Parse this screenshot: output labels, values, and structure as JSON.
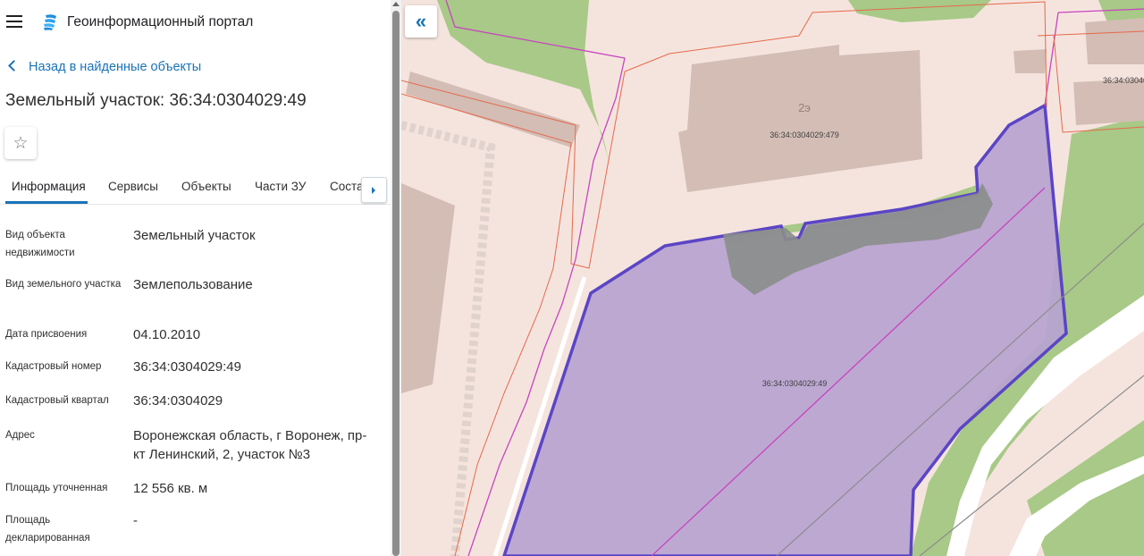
{
  "app": {
    "title": "Геоинформационный портал"
  },
  "nav": {
    "back_label": "Назад в найденные объекты"
  },
  "object": {
    "title": "Земельный участок: 36:34:0304029:49"
  },
  "tabs": [
    {
      "label": "Информация",
      "active": true
    },
    {
      "label": "Сервисы"
    },
    {
      "label": "Объекты"
    },
    {
      "label": "Части ЗУ"
    },
    {
      "label": "Состав"
    }
  ],
  "info": [
    {
      "label": "Вид объекта недвижимости",
      "value": "Земельный участок"
    },
    {
      "label": "Вид земельного участка",
      "value": "Землепользование"
    },
    {
      "label": "Дата присвоения",
      "value": "04.10.2010"
    },
    {
      "label": "Кадастровый номер",
      "value": "36:34:0304029:49"
    },
    {
      "label": "Кадастровый квартал",
      "value": "36:34:0304029"
    },
    {
      "label": "Адрес",
      "value": "Воронежская область, г Воронеж, пр-кт Ленинский, 2, участок №3"
    },
    {
      "label": "Площадь уточненная",
      "value": "12 556 кв. м"
    },
    {
      "label": "Площадь декларированная",
      "value": "-"
    }
  ],
  "map": {
    "building_number": "2э",
    "building_cadastral": "36:34:0304029:479",
    "parcel_cadastral": "36:34:0304029:49",
    "right_label": "36:34:0304029",
    "colors": {
      "background": "#f5e4de",
      "green": "#a8c987",
      "building": "#d3bdb5",
      "parcel_fill": "#b7a3d0",
      "parcel_border": "#5b45c5",
      "orange_line": "#e5694b",
      "magenta_line": "#c745c0"
    }
  },
  "icons": {
    "menu": "menu-icon",
    "logo": "logo-icon",
    "back": "chevron-left-icon",
    "favorite": "star-icon",
    "collapse": "double-chevron-left-icon"
  }
}
